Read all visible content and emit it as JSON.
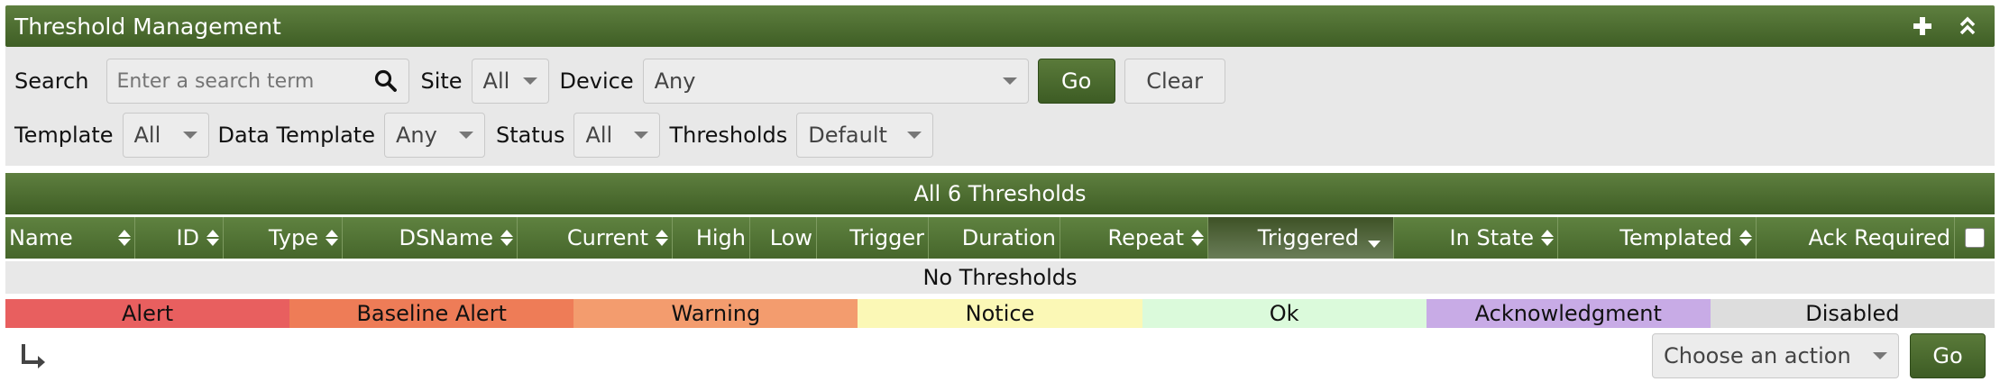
{
  "header": {
    "title": "Threshold Management",
    "add_icon": "plus-icon",
    "collapse_icon": "chevrons-up-icon"
  },
  "filters": {
    "search_label": "Search",
    "search_placeholder": "Enter a search term",
    "site_label": "Site",
    "site_value": "All",
    "device_label": "Device",
    "device_value": "Any",
    "go_label": "Go",
    "clear_label": "Clear",
    "template_label": "Template",
    "template_value": "All",
    "data_template_label": "Data Template",
    "data_template_value": "Any",
    "status_label": "Status",
    "status_value": "All",
    "thresholds_label": "Thresholds",
    "thresholds_value": "Default"
  },
  "table": {
    "title": "All 6 Thresholds",
    "columns": {
      "name": "Name",
      "id": "ID",
      "type": "Type",
      "dsname": "DSName",
      "current": "Current",
      "high": "High",
      "low": "Low",
      "trigger": "Trigger",
      "duration": "Duration",
      "repeat": "Repeat",
      "triggered": "Triggered",
      "in_state": "In State",
      "templated": "Templated",
      "ack_required": "Ack Required"
    },
    "empty_text": "No Thresholds"
  },
  "legend": [
    {
      "label": "Alert",
      "color": "#e85f5f"
    },
    {
      "label": "Baseline Alert",
      "color": "#ee7c57"
    },
    {
      "label": "Warning",
      "color": "#f39c6e"
    },
    {
      "label": "Notice",
      "color": "#fbf8b6"
    },
    {
      "label": "Ok",
      "color": "#dbfadb"
    },
    {
      "label": "Acknowledgment",
      "color": "#c8abe6"
    },
    {
      "label": "Disabled",
      "color": "#dddddd"
    }
  ],
  "footer": {
    "action_placeholder": "Choose an action",
    "go_label": "Go"
  },
  "colors": {
    "header_green": "#4a6a2e",
    "accent_dark": "#3d5c24"
  }
}
